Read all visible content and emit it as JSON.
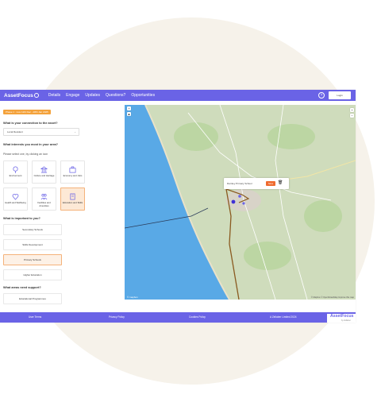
{
  "nav": {
    "logo": "AssetFocus",
    "items": [
      "Details",
      "Engage",
      "Updates",
      "Questions?",
      "Opportunities"
    ],
    "help": "?",
    "login": "Login"
  },
  "colors": {
    "brand": "#6a63e6",
    "accent": "#ef6b2f",
    "tag": "#f4a23b",
    "selected_bg": "#fde9d6"
  },
  "left": {
    "tag": "Phase 1 · Live 12th Dec - 28th Jan 2025",
    "q1": "What is your connection to the asset?",
    "select_value": "Local Resident",
    "q2": "What interests you most in your area?",
    "q2_hint": "Please select one, by clicking an icon",
    "tiles": [
      {
        "label": "Environment",
        "icon": "tree-icon",
        "selected": false
      },
      {
        "label": "Culture and Heritage",
        "icon": "museum-icon",
        "selected": false
      },
      {
        "label": "Economy and Jobs",
        "icon": "briefcase-icon",
        "selected": false
      },
      {
        "label": "Health and Wellbeing",
        "icon": "heart-icon",
        "selected": false
      },
      {
        "label": "Facilities and Amenities",
        "icon": "people-icon",
        "selected": false
      },
      {
        "label": "Education and Skills",
        "icon": "book-icon",
        "selected": true
      }
    ],
    "q3": "What is important to you?",
    "options": [
      "Secondary Schools",
      "Skills Development",
      "Primary Schools",
      "Higher Education"
    ],
    "selected_option": "Primary Schools",
    "q4": "What areas need support?",
    "q4_option": "Educational Programmes"
  },
  "map": {
    "popup_text": "Darnley Primary School",
    "save_label": "Save",
    "zoom_in": "+",
    "zoom_out": "−",
    "compass": "▲",
    "attribution": "© Mapbox © OpenStreetMap Improve this map",
    "maplogo": "© mapbox"
  },
  "footer": {
    "links": [
      "User Terms",
      "Privacy Policy",
      "Cookies Policy",
      "A Zellaber Limited 2024"
    ],
    "logo": "AssetFocus",
    "logo_sub": "by Zellaber"
  }
}
